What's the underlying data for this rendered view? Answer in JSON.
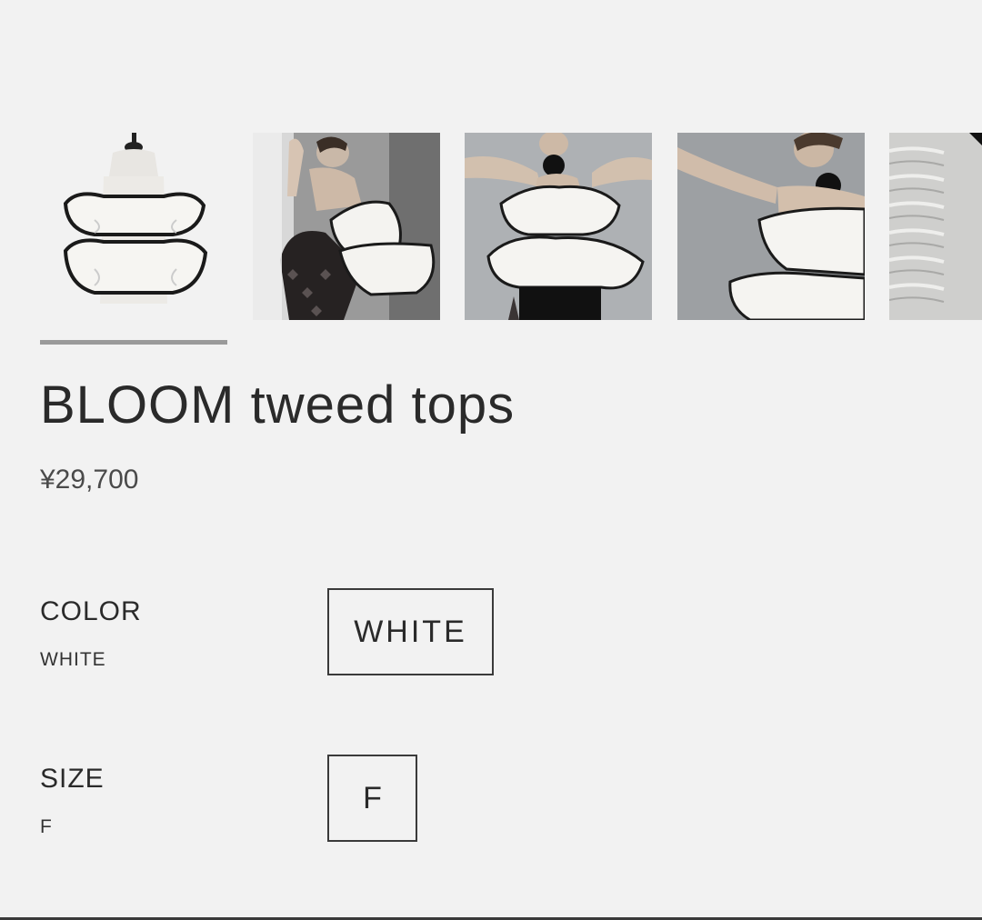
{
  "gallery": {
    "thumbnails": [
      {
        "icon": "product-mannequin-image"
      },
      {
        "icon": "model-photo-image"
      },
      {
        "icon": "model-photo-image"
      },
      {
        "icon": "model-photo-image"
      },
      {
        "icon": "fabric-closeup-image"
      }
    ],
    "active_index": 0
  },
  "product": {
    "title": "BLOOM tweed tops",
    "price": "¥29,700"
  },
  "options": {
    "color": {
      "label": "COLOR",
      "selected": "WHITE",
      "choices": [
        "WHITE"
      ]
    },
    "size": {
      "label": "SIZE",
      "selected": "F",
      "choices": [
        "F"
      ]
    }
  },
  "colors": {
    "background": "#f2f2f2",
    "text": "#2b2b2b",
    "indicator": "#9a9a9a",
    "border": "#3a3a3a"
  }
}
